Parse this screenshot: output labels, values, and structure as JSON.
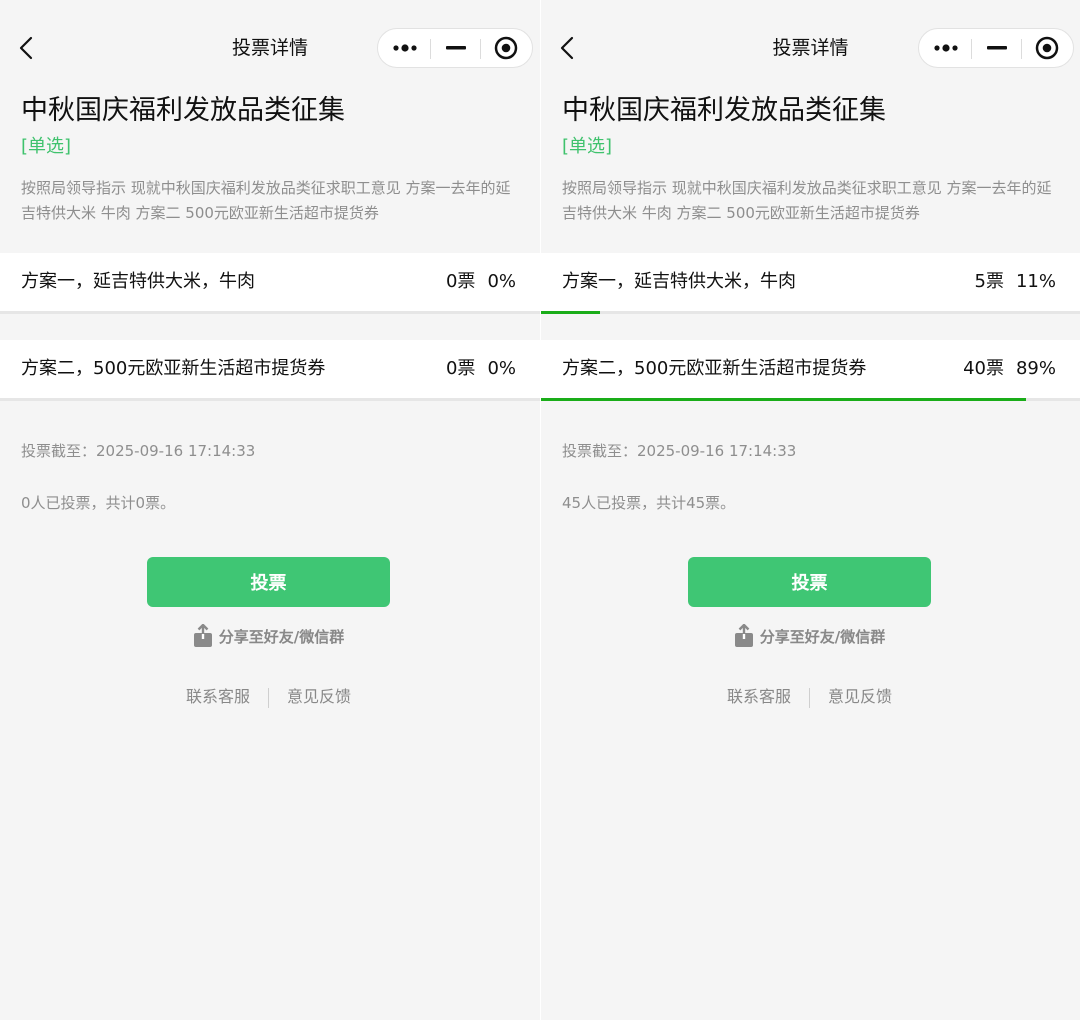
{
  "panels": [
    {
      "nav_title": "投票详情",
      "title": "中秋国庆福利发放品类征集",
      "tag": "[单选]",
      "description": "按照局领导指示 现就中秋国庆福利发放品类征求职工意见 方案一去年的延吉特供大米 牛肉 方案二 500元欧亚新生活超市提货券",
      "options": [
        {
          "label": "方案一，延吉特供大米，牛肉",
          "votes": "0票",
          "percent": "0%",
          "fraction": 0
        },
        {
          "label": "方案二，500元欧亚新生活超市提货券",
          "votes": "0票",
          "percent": "0%",
          "fraction": 0
        }
      ],
      "deadline": "投票截至：2025-09-16 17:14:33",
      "summary": "0人已投票，共计0票。",
      "vote_button": "投票",
      "share": "分享至好友/微信群",
      "contact": "联系客服",
      "feedback": "意见反馈"
    },
    {
      "nav_title": "投票详情",
      "title": "中秋国庆福利发放品类征集",
      "tag": "[单选]",
      "description": "按照局领导指示 现就中秋国庆福利发放品类征求职工意见 方案一去年的延吉特供大米 牛肉 方案二 500元欧亚新生活超市提货券",
      "options": [
        {
          "label": "方案一，延吉特供大米，牛肉",
          "votes": "5票",
          "percent": "11%",
          "fraction": 0.11
        },
        {
          "label": "方案二，500元欧亚新生活超市提货券",
          "votes": "40票",
          "percent": "89%",
          "fraction": 0.9
        }
      ],
      "deadline": "投票截至：2025-09-16 17:14:33",
      "summary": "45人已投票，共计45票。",
      "vote_button": "投票",
      "share": "分享至好友/微信群",
      "contact": "联系客服",
      "feedback": "意见反馈"
    }
  ],
  "colors": {
    "accent_green": "#3fc674",
    "progress_green": "#1aad19",
    "tag_green": "#3fc26d",
    "muted_text": "#8e8e8e"
  },
  "icons": {
    "back": "chevron-left-icon",
    "more": "more-dots-icon",
    "minimize": "minimize-icon",
    "close": "target-close-icon",
    "share": "share-upload-icon"
  }
}
